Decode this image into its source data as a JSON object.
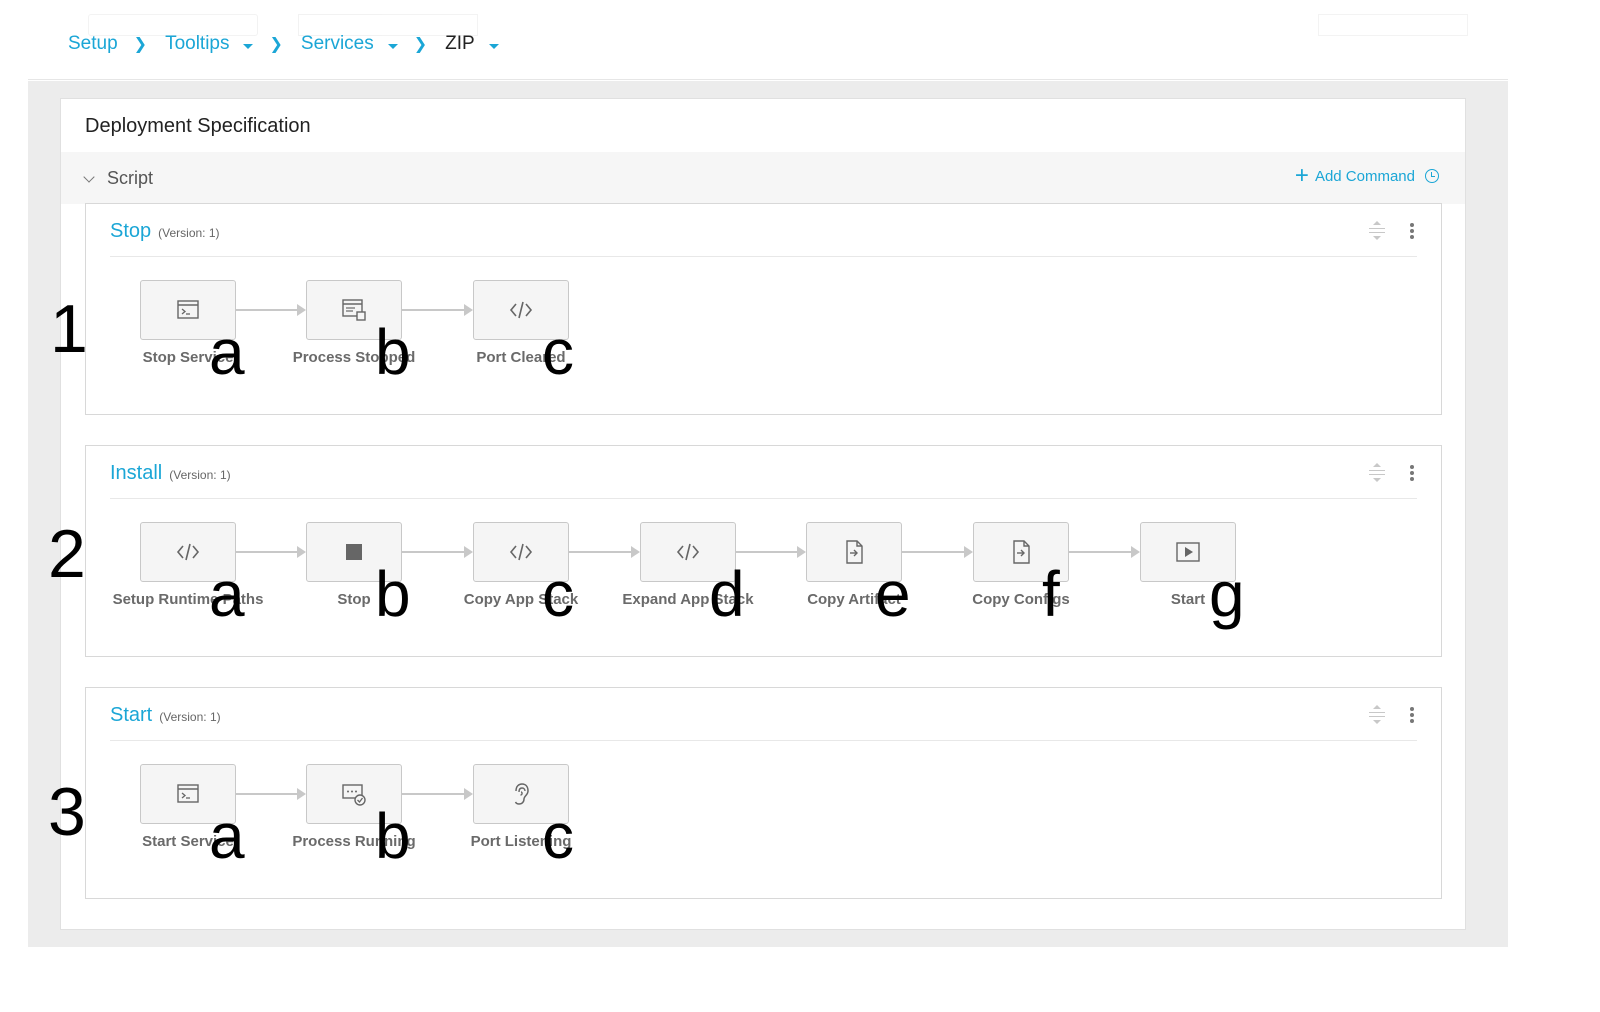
{
  "breadcrumb": [
    {
      "label": "Setup",
      "has_menu": false,
      "current": false
    },
    {
      "label": "Tooltips",
      "has_menu": true,
      "current": false
    },
    {
      "label": "Services",
      "has_menu": true,
      "current": false
    },
    {
      "label": "ZIP",
      "has_menu": true,
      "current": true
    }
  ],
  "panel": {
    "title": "Deployment Specification",
    "section_label": "Script",
    "add_command_label": "Add Command"
  },
  "cards": [
    {
      "name": "Stop",
      "version": "(Version: 1)",
      "number": "1",
      "steps": [
        {
          "label": "Stop Service",
          "icon": "terminal-icon",
          "letter": "a"
        },
        {
          "label": "Process Stopped",
          "icon": "process-window-icon",
          "letter": "b"
        },
        {
          "label": "Port Cleared",
          "icon": "code-icon",
          "letter": "c"
        }
      ]
    },
    {
      "name": "Install",
      "version": "(Version: 1)",
      "number": "2",
      "steps": [
        {
          "label": "Setup Runtime Paths",
          "icon": "code-icon",
          "letter": "a"
        },
        {
          "label": "Stop",
          "icon": "stop-square-icon",
          "letter": "b"
        },
        {
          "label": "Copy App Stack",
          "icon": "code-icon",
          "letter": "c"
        },
        {
          "label": "Expand App Stack",
          "icon": "code-icon",
          "letter": "d"
        },
        {
          "label": "Copy Artifact",
          "icon": "file-copy-icon",
          "letter": "e"
        },
        {
          "label": "Copy Configs",
          "icon": "file-copy-icon",
          "letter": "f"
        },
        {
          "label": "Start",
          "icon": "play-icon",
          "letter": "g"
        }
      ]
    },
    {
      "name": "Start",
      "version": "(Version: 1)",
      "number": "3",
      "steps": [
        {
          "label": "Start Service",
          "icon": "terminal-icon",
          "letter": "a"
        },
        {
          "label": "Process Running",
          "icon": "process-running-icon",
          "letter": "b"
        },
        {
          "label": "Port Listening",
          "icon": "ear-icon",
          "letter": "c"
        }
      ]
    }
  ],
  "colors": {
    "accent": "#1ba6d6",
    "background": "#ececec",
    "step_fill": "#f5f5f5",
    "step_border": "#c8c8c8"
  }
}
